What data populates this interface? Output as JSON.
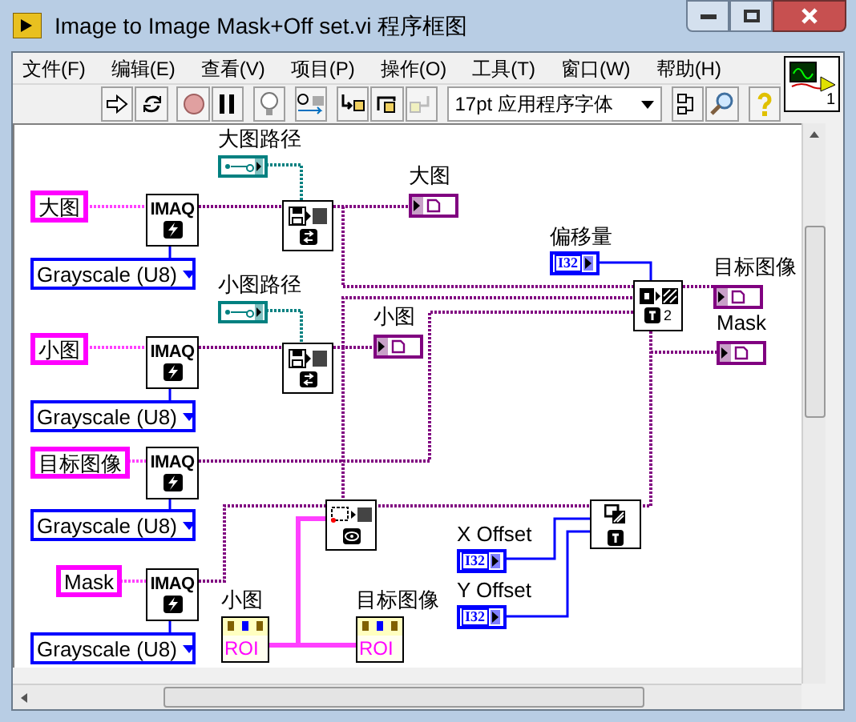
{
  "window": {
    "title": "Image to Image Mask+Off set.vi 程序框图"
  },
  "menu": [
    "文件(F)",
    "编辑(E)",
    "查看(V)",
    "项目(P)",
    "操作(O)",
    "工具(T)",
    "窗口(W)",
    "帮助(H)"
  ],
  "toolbar": {
    "font": "17pt 应用程序字体"
  },
  "vi_icon": {
    "text": "1"
  },
  "diagram": {
    "string_controls": [
      {
        "label": "大图"
      },
      {
        "label": "小图"
      },
      {
        "label": "目标图像"
      },
      {
        "label": "Mask"
      }
    ],
    "imaq_nodes": [
      {
        "text": "IMAQ"
      },
      {
        "text": "IMAQ"
      },
      {
        "text": "IMAQ"
      },
      {
        "text": "IMAQ"
      }
    ],
    "enums": [
      {
        "value": "Grayscale (U8)"
      },
      {
        "value": "Grayscale (U8)"
      },
      {
        "value": "Grayscale (U8)"
      },
      {
        "value": "Grayscale (U8)"
      }
    ],
    "path_constants": [
      {
        "label": "大图路径"
      },
      {
        "label": "小图路径"
      }
    ],
    "image_indicators": [
      {
        "label": "大图"
      },
      {
        "label": "小图"
      },
      {
        "label": "目标图像"
      },
      {
        "label": "Mask"
      }
    ],
    "numeric_controls": [
      {
        "label": "偏移量",
        "type": "I32"
      },
      {
        "label": "X Offset",
        "type": "I32"
      },
      {
        "label": "Y Offset",
        "type": "I32"
      }
    ],
    "roi_constants": [
      {
        "label": "小图",
        "text": "ROI"
      },
      {
        "label": "目标图像",
        "text": "ROI"
      }
    ],
    "copy_node": {
      "count": "2"
    }
  }
}
